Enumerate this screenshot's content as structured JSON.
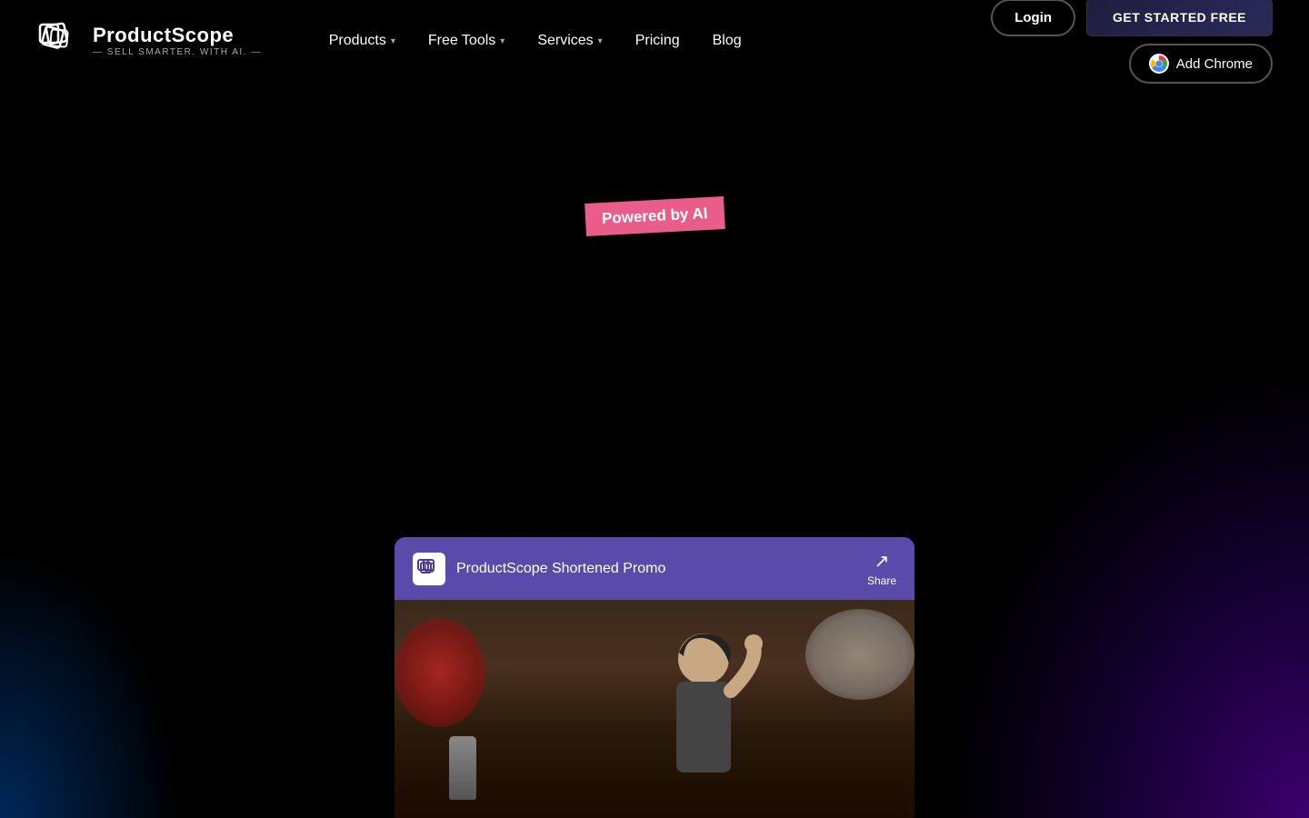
{
  "brand": {
    "name": "ProductScope",
    "tagline": "— SELL SMARTER. WITH AI. —"
  },
  "nav": {
    "products_label": "Products",
    "free_tools_label": "Free Tools",
    "services_label": "Services",
    "pricing_label": "Pricing",
    "blog_label": "Blog"
  },
  "cta": {
    "login_label": "Login",
    "get_started_label": "GET STARTED FREE",
    "add_chrome_label": "Add Chrome"
  },
  "badge": {
    "text": "Powered by AI"
  },
  "video": {
    "title": "ProductScope Shortened Promo",
    "share_label": "Share"
  },
  "colors": {
    "accent_pink": "#e85d8a",
    "nav_bg": "#000000",
    "btn_border": "#555555"
  }
}
